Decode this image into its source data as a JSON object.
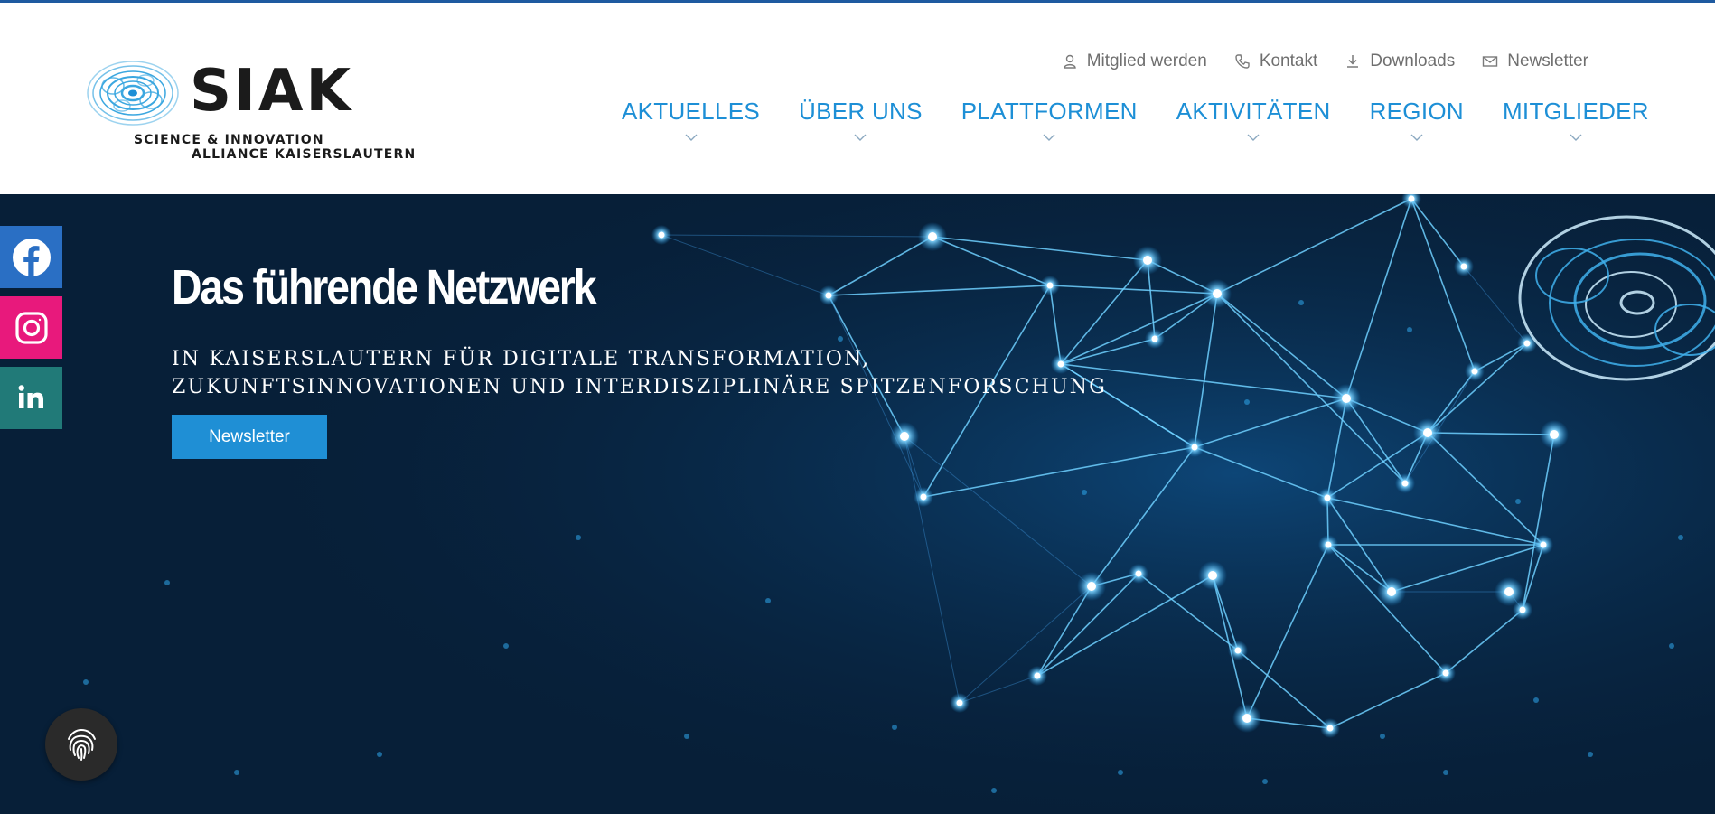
{
  "logo": {
    "name": "SIAK",
    "sub_line1": "SCIENCE & INNOVATION",
    "sub_line2": "ALLIANCE KAISERSLAUTERN"
  },
  "util_nav": [
    {
      "label": "Mitglied werden",
      "icon": "user-icon"
    },
    {
      "label": "Kontakt",
      "icon": "phone-icon"
    },
    {
      "label": "Downloads",
      "icon": "download-icon"
    },
    {
      "label": "Newsletter",
      "icon": "mail-icon"
    }
  ],
  "main_nav": [
    {
      "label": "AKTUELLES"
    },
    {
      "label": "ÜBER UNS"
    },
    {
      "label": "PLATTFORMEN"
    },
    {
      "label": "AKTIVITÄTEN"
    },
    {
      "label": "REGION"
    },
    {
      "label": "MITGLIEDER"
    }
  ],
  "hero": {
    "title": "Das führende Netzwerk",
    "subtitle_line1": "IN KAISERSLAUTERN FÜR DIGITALE TRANSFORMATION,",
    "subtitle_line2": "ZUKUNFTSINNOVATIONEN UND INTERDISZIPLINÄRE SPITZENFORSCHUNG",
    "button_label": "Newsletter"
  },
  "social": [
    {
      "name": "facebook-icon",
      "color": "#2a6fc4"
    },
    {
      "name": "instagram-icon",
      "color": "#e8197c"
    },
    {
      "name": "linkedin-icon",
      "color": "#217a78"
    }
  ],
  "colors": {
    "accent": "#1d8fd6",
    "hero_bg": "#071f38",
    "topline": "#1e5aa0"
  }
}
